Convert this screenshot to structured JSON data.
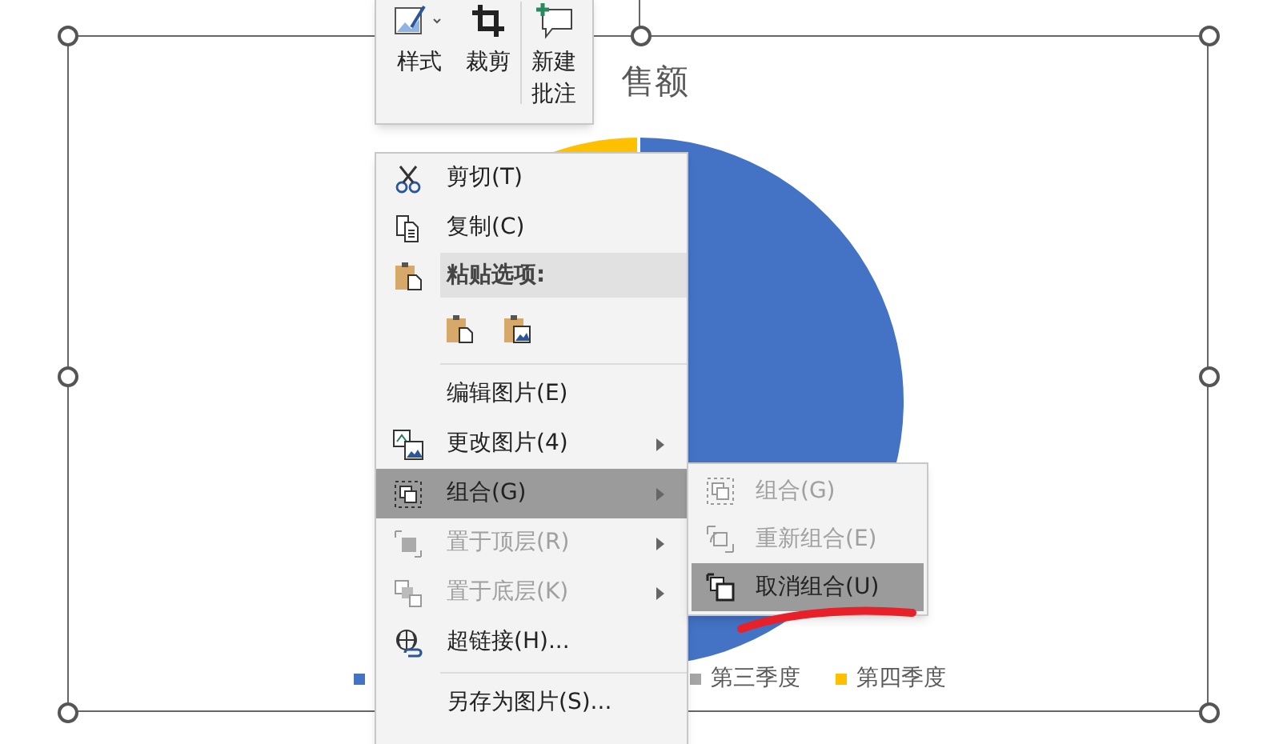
{
  "chart": {
    "title": "售额",
    "legend": [
      {
        "color": "#4472c4"
      },
      {
        "label": "第三季度",
        "color": "#a5a5a5"
      },
      {
        "label": "第四季度",
        "color": "#ffc000"
      }
    ]
  },
  "mini_toolbar": [
    {
      "kind": "style",
      "label": "样式"
    },
    {
      "kind": "crop",
      "label": "裁剪"
    },
    {
      "kind": "comment",
      "label": "新建批注"
    }
  ],
  "context_menu": [
    {
      "kind": "item",
      "label": "剪切(T)",
      "disabled": false,
      "selected": false,
      "submenu": false
    },
    {
      "kind": "item",
      "label": "复制(C)",
      "disabled": false,
      "selected": false,
      "submenu": false
    },
    {
      "kind": "header",
      "label": "粘贴选项:"
    },
    {
      "kind": "paste_options"
    },
    {
      "kind": "separator"
    },
    {
      "kind": "item",
      "label": "编辑图片(E)",
      "disabled": false,
      "selected": false,
      "submenu": false
    },
    {
      "kind": "item",
      "label": "更改图片(4)",
      "disabled": false,
      "selected": false,
      "submenu": true
    },
    {
      "kind": "item",
      "label": "组合(G)",
      "disabled": false,
      "selected": true,
      "submenu": true
    },
    {
      "kind": "item",
      "label": "置于顶层(R)",
      "disabled": true,
      "selected": false,
      "submenu": true
    },
    {
      "kind": "item",
      "label": "置于底层(K)",
      "disabled": true,
      "selected": false,
      "submenu": true
    },
    {
      "kind": "item",
      "label": "超链接(H)...",
      "disabled": false,
      "selected": false,
      "submenu": false
    },
    {
      "kind": "separator"
    },
    {
      "kind": "item",
      "label": "另存为图片(S)...",
      "disabled": false,
      "selected": false,
      "submenu": false
    }
  ],
  "submenu": [
    {
      "label": "组合(G)",
      "disabled": true,
      "selected": false
    },
    {
      "label": "重新组合(E)",
      "disabled": true,
      "selected": false
    },
    {
      "label": "取消组合(U)",
      "disabled": false,
      "selected": true
    }
  ]
}
